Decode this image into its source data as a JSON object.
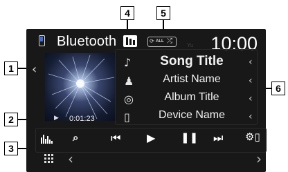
{
  "header": {
    "source_title": "Bluetooth",
    "clock": "10:00",
    "faint_text": "Yu"
  },
  "track": {
    "song_title": "Song Title",
    "artist_name": "Artist Name",
    "album_title": "Album Title",
    "device_name": "Device Name",
    "time": "0:01:23"
  },
  "repeat_label": "ALL",
  "callouts": {
    "c1": "1",
    "c2": "2",
    "c3": "3",
    "c4": "4",
    "c5": "5",
    "c6": "6"
  },
  "icons": [
    "source-icon",
    "bluetooth-signal-icon",
    "repeat-all-icon",
    "shuffle-icon",
    "music-note-icon",
    "artist-icon",
    "album-icon",
    "device-icon",
    "equalizer-icon",
    "search-icon",
    "previous-track-icon",
    "play-icon",
    "pause-icon",
    "next-track-icon",
    "settings-icon",
    "menu-grid-icon",
    "chevron-left-icon",
    "chevron-right-icon"
  ],
  "colors": {
    "screen_bg": "#181818",
    "accent_blue": "#3b6ee6",
    "text": "#ffffff"
  }
}
